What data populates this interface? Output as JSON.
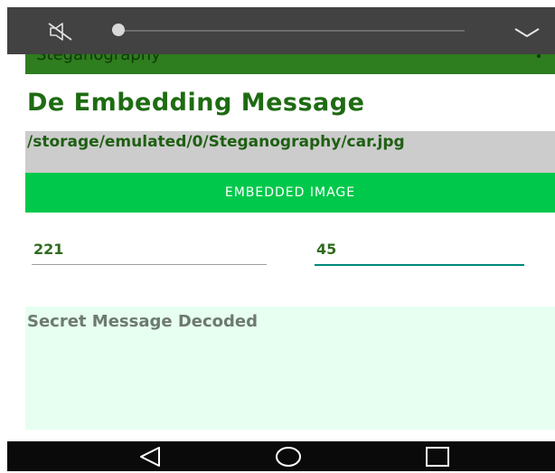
{
  "volume_panel": {
    "icons": {
      "mute": "volume-off-icon",
      "collapse": "chevron-down-icon"
    },
    "level": 0.0
  },
  "toolbar": {
    "title": "Steganography",
    "overflow_icon": "overflow-menu-icon"
  },
  "page": {
    "title": "De Embedding Message",
    "file_path": "/storage/emulated/0/Steganography/car.jpg",
    "embed_button_label": "EMBEDDED IMAGE",
    "field_x_value": "221",
    "field_y_value": "45",
    "message_placeholder": "Secret Message Decoded"
  },
  "nav_bar": {
    "icons": [
      "back-icon",
      "home-icon",
      "recents-icon"
    ]
  },
  "colors": {
    "accent_green": "#00c84b",
    "title_green": "#1e6b12",
    "toolbar_green": "#2e7d1e",
    "field_focus": "#00897b",
    "message_bg": "#e6fff0"
  }
}
